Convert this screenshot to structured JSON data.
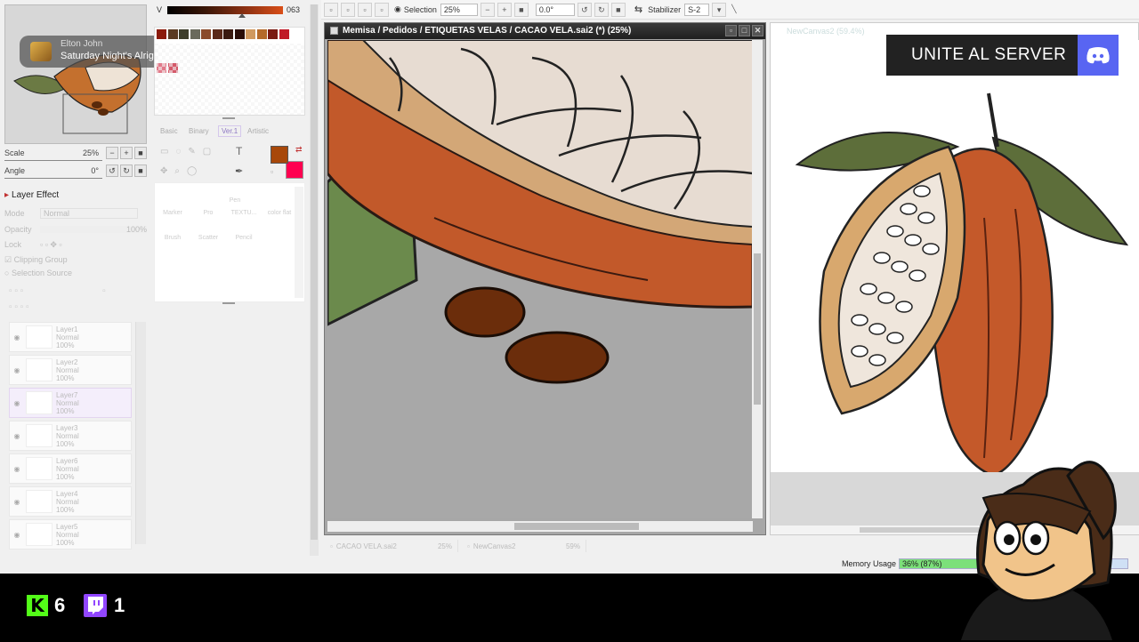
{
  "now_playing": {
    "artist": "Elton John",
    "title": "Saturday Night's Alrig..."
  },
  "navigator": {
    "scale_label": "Scale",
    "scale_value": "25%",
    "angle_label": "Angle",
    "angle_value": "0°"
  },
  "color_panel": {
    "v_label": "V",
    "v_value": "063",
    "fg_color": "#a8480a",
    "bg_color": "#ff0050",
    "swatches": [
      "#8b1a0a",
      "#5a3a22",
      "#3d3d2b",
      "#6a6a5c",
      "#8a4a2a",
      "#5a2a1a",
      "#3a1a10",
      "#2a0e08",
      "#d09a60",
      "#b46a2a",
      "#7a1a12",
      "#c01a28",
      "#e27a8a",
      "#d45a6a"
    ]
  },
  "brush_tabs": [
    {
      "label": "Basic",
      "active": false
    },
    {
      "label": "Binary",
      "active": false
    },
    {
      "label": "Ver.1",
      "active": true
    },
    {
      "label": "Artistic",
      "active": false
    }
  ],
  "tools": [
    "Pen",
    "Marker",
    "Pro",
    "TEXTU...",
    "color flat",
    "Brush",
    "Scatter",
    "Pencil"
  ],
  "layer_panel": {
    "title": "Layer Effect",
    "mode_label": "Mode",
    "mode_value": "Normal",
    "opacity_label": "Opacity",
    "opacity_value": "100%",
    "lock_label": "Lock",
    "clipping_label": "Clipping Group",
    "selection_source_label": "Selection Source",
    "layers": [
      {
        "name": "Layer1",
        "mode": "Normal",
        "opacity": "100%",
        "selected": false
      },
      {
        "name": "Layer2",
        "mode": "Normal",
        "opacity": "100%",
        "selected": false
      },
      {
        "name": "Layer7",
        "mode": "Normal",
        "opacity": "100%",
        "selected": true
      },
      {
        "name": "Layer3",
        "mode": "Normal",
        "opacity": "100%",
        "selected": false
      },
      {
        "name": "Layer6",
        "mode": "Normal",
        "opacity": "100%",
        "selected": false
      },
      {
        "name": "Layer4",
        "mode": "Normal",
        "opacity": "100%",
        "selected": false
      },
      {
        "name": "Layer5",
        "mode": "Normal",
        "opacity": "100%",
        "selected": false
      }
    ]
  },
  "toolbar": {
    "selection_label": "Selection",
    "zoom_value": "25%",
    "rotation_value": "0.0°",
    "stabilizer_label": "Stabilizer",
    "stabilizer_value": "S-2"
  },
  "canvas1": {
    "title": "Memisa / Pedidos / ETIQUETAS VELAS / CACAO VELA.sai2 (*) (25%)"
  },
  "canvas2": {
    "title": "NewCanvas2 (59.4%)"
  },
  "discord_banner": {
    "text": "UNITE AL SERVER",
    "color": "#5865f2"
  },
  "doc_tabs": [
    {
      "name": "CACAO VELA.sai2",
      "zoom": "25%"
    },
    {
      "name": "NewCanvas2",
      "zoom": "59%"
    }
  ],
  "memory": {
    "label": "Memory Usage",
    "value": "36% (87%)",
    "fraction": 0.36
  },
  "stream_stats": {
    "kick_count": "6",
    "twitch_count": "1",
    "kick_color": "#53fc18",
    "twitch_color": "#9146ff"
  }
}
